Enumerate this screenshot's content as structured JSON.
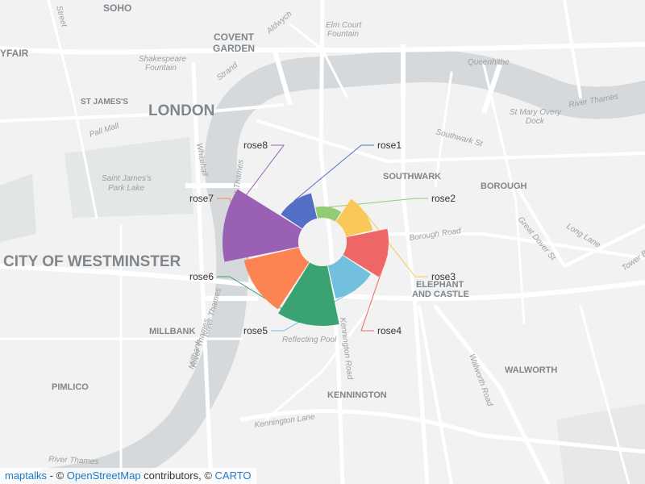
{
  "map": {
    "places": [
      {
        "key": "soho",
        "label": "SOHO"
      },
      {
        "key": "mayfair",
        "label": "YFAIR"
      },
      {
        "key": "covent-garden-1",
        "label": "COVENT"
      },
      {
        "key": "covent-garden-2",
        "label": "GARDEN"
      },
      {
        "key": "london",
        "label": "LONDON"
      },
      {
        "key": "st-jamess",
        "label": "ST JAMES'S"
      },
      {
        "key": "westminster",
        "label": "CITY OF WESTMINSTER"
      },
      {
        "key": "southwark",
        "label": "SOUTHWARK"
      },
      {
        "key": "borough",
        "label": "BOROUGH"
      },
      {
        "key": "elephant-1",
        "label": "ELEPHANT"
      },
      {
        "key": "elephant-2",
        "label": "AND CASTLE"
      },
      {
        "key": "millbank",
        "label": "MILLBANK"
      },
      {
        "key": "pimlico",
        "label": "PIMLICO"
      },
      {
        "key": "walworth",
        "label": "WALWORTH"
      },
      {
        "key": "kennington",
        "label": "KENNINGTON"
      }
    ],
    "streets": [
      {
        "key": "strand",
        "label": "Strand"
      },
      {
        "key": "aldwych",
        "label": "Aldwych"
      },
      {
        "key": "pall-mall",
        "label": "Pall Mall"
      },
      {
        "key": "whitehall",
        "label": "Whitehall"
      },
      {
        "key": "river-thames-w",
        "label": "River Thames"
      },
      {
        "key": "river-thames-ne",
        "label": "River Thames"
      },
      {
        "key": "river-thames-s",
        "label": "River Thames"
      },
      {
        "key": "river-thames-sw",
        "label": "River Thames"
      },
      {
        "key": "river-thames-bottom",
        "label": "River Thames"
      },
      {
        "key": "southwark-st",
        "label": "Southwark St"
      },
      {
        "key": "borough-road",
        "label": "Borough Road"
      },
      {
        "key": "long-lane",
        "label": "Long Lane"
      },
      {
        "key": "great-dover",
        "label": "Great Dover St"
      },
      {
        "key": "tower-bridge",
        "label": "Tower Bridge Rd"
      },
      {
        "key": "walworth-road",
        "label": "Walworth Road"
      },
      {
        "key": "kennington-lane",
        "label": "Kennington Lane"
      },
      {
        "key": "kennington-road",
        "label": "Kennington Road"
      },
      {
        "key": "queenhithe",
        "label": "Queenhithe"
      },
      {
        "key": "elm-court-1",
        "label": "Elm Court"
      },
      {
        "key": "elm-court-2",
        "label": "Fountain"
      },
      {
        "key": "shakespeare-1",
        "label": "Shakespeare"
      },
      {
        "key": "shakespeare-2",
        "label": "Fountain"
      },
      {
        "key": "st-james-park-1",
        "label": "Saint James's"
      },
      {
        "key": "st-james-park-2",
        "label": "Park Lake"
      },
      {
        "key": "st-mary-1",
        "label": "St Mary Overy"
      },
      {
        "key": "st-mary-2",
        "label": "Dock"
      },
      {
        "key": "reflecting-pool",
        "label": "Reflecting Pool"
      },
      {
        "key": "millbank-st",
        "label": "Millbank"
      },
      {
        "key": "top-street",
        "label": "Street"
      }
    ]
  },
  "rose": {
    "series": [
      {
        "name": "rose1",
        "value": 1.6,
        "color": "#5470c6"
      },
      {
        "name": "rose2",
        "value": 0.7,
        "color": "#91cc75"
      },
      {
        "name": "rose3",
        "value": 1.7,
        "color": "#fac858"
      },
      {
        "name": "rose4",
        "value": 2.6,
        "color": "#ee6666"
      },
      {
        "name": "rose5",
        "value": 2.1,
        "color": "#73c0de"
      },
      {
        "name": "rose6",
        "value": 3.7,
        "color": "#3ba272"
      },
      {
        "name": "rose7",
        "value": 3.5,
        "color": "#fc8452"
      },
      {
        "name": "rose8",
        "value": 4.7,
        "color": "#9a60b4"
      }
    ]
  },
  "attribution": {
    "maptalks": "maptalks",
    "sep1": " - © ",
    "osm": "OpenStreetMap",
    "contributors": " contributors, © ",
    "carto": "CARTO"
  }
}
